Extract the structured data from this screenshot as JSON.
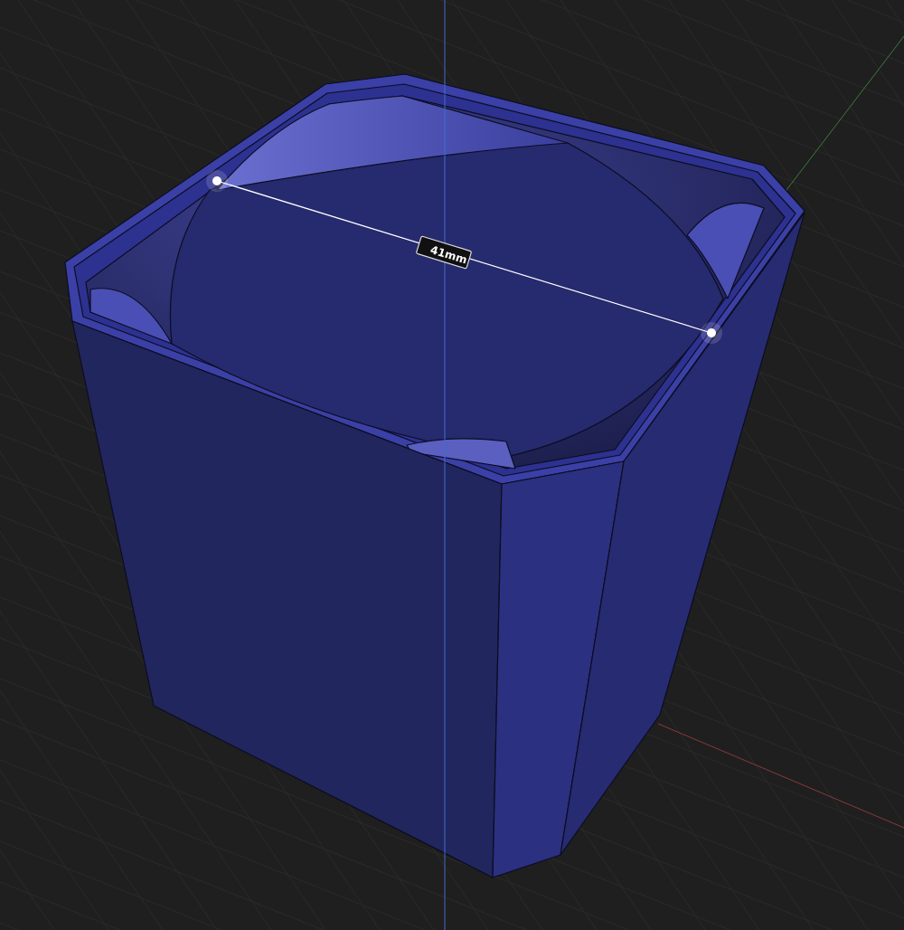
{
  "measurement": {
    "label": "41mm"
  }
}
